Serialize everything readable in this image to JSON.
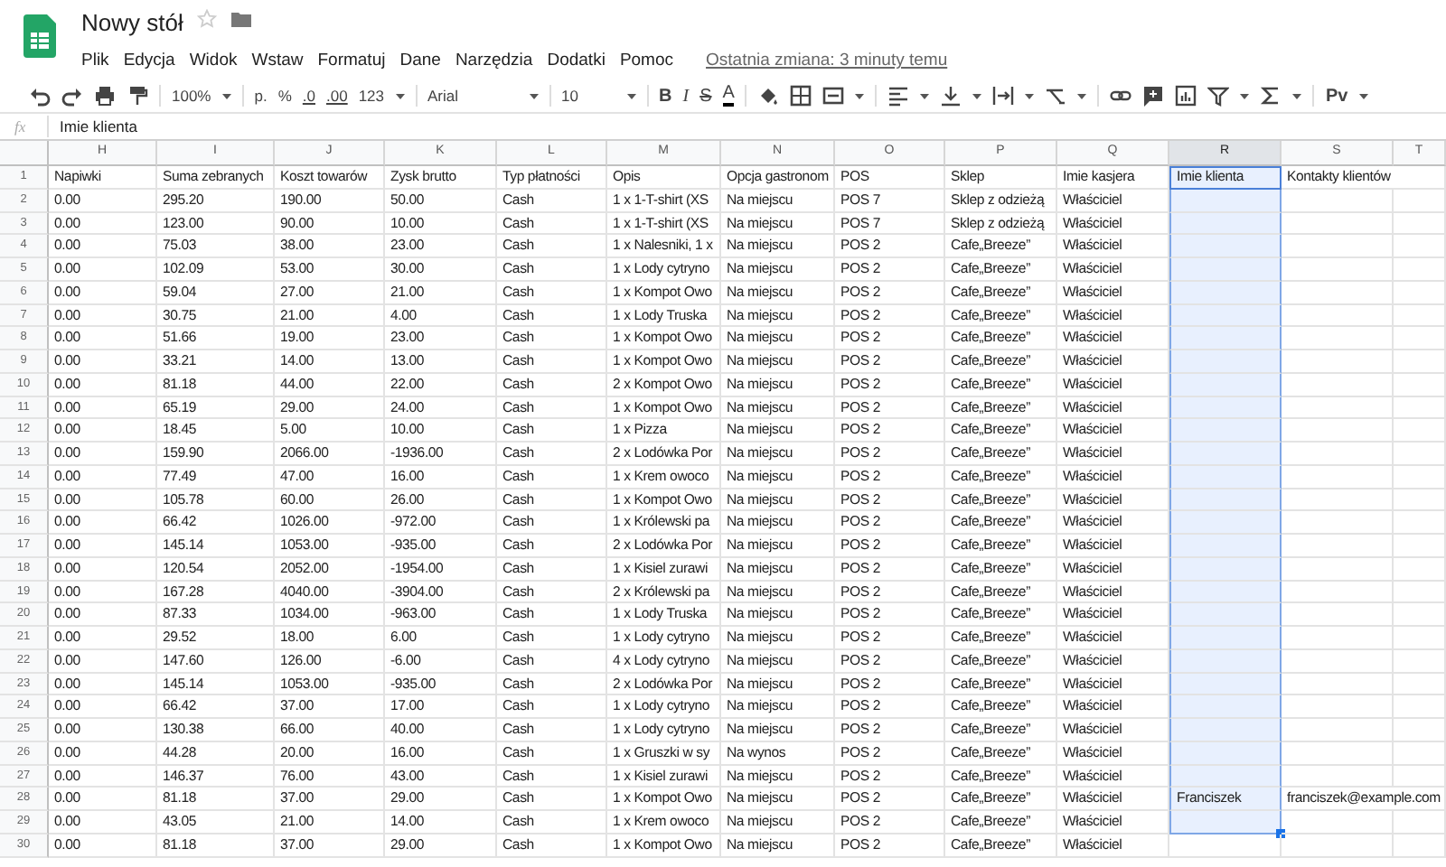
{
  "document": {
    "title": "Nowy stół",
    "starred": false
  },
  "menu": [
    "Plik",
    "Edycja",
    "Widok",
    "Wstaw",
    "Formatuj",
    "Dane",
    "Narzędzia",
    "Dodatki",
    "Pomoc"
  ],
  "last_edit": "Ostatnia zmiana: 3 minuty temu",
  "toolbar": {
    "zoom": "100%",
    "currency": "p.",
    "percent": "%",
    "decimal_less": ".0",
    "decimal_more": ".00",
    "number_format": "123",
    "font": "Arial",
    "font_size": "10",
    "bold": "B",
    "italic": "I",
    "strikethrough": "S",
    "text_color": "A",
    "input_tools": "Pv"
  },
  "formula_bar": {
    "label": "fx",
    "value": "Imie klienta"
  },
  "columns": [
    {
      "letter": "H",
      "selected": false
    },
    {
      "letter": "I",
      "selected": false
    },
    {
      "letter": "J",
      "selected": false
    },
    {
      "letter": "K",
      "selected": false
    },
    {
      "letter": "L",
      "selected": false
    },
    {
      "letter": "M",
      "selected": false
    },
    {
      "letter": "N",
      "selected": false
    },
    {
      "letter": "O",
      "selected": false
    },
    {
      "letter": "P",
      "selected": false
    },
    {
      "letter": "Q",
      "selected": false
    },
    {
      "letter": "R",
      "selected": true
    },
    {
      "letter": "S",
      "selected": false
    },
    {
      "letter": "T",
      "selected": false
    }
  ],
  "rows": [
    {
      "number": "1",
      "selected": true,
      "cells": [
        "Napiwki",
        "Suma zebranych",
        "Koszt towarów",
        "Zysk brutto",
        "Typ płatności",
        "Opis",
        "Opcja gastronom",
        "POS",
        "Sklep",
        "Imie kasjera",
        "Imie klienta",
        "Kontakty klientów",
        null
      ]
    },
    {
      "number": "2",
      "selected": true,
      "cells": [
        "0.00",
        "295.20",
        "190.00",
        "50.00",
        "Cash",
        "1 x 1-T-shirt (XS",
        "Na miejscu",
        "POS 7",
        "Sklep z odzieżą",
        "Właściciel",
        null,
        null,
        null
      ]
    },
    {
      "number": "3",
      "selected": true,
      "cells": [
        "0.00",
        "123.00",
        "90.00",
        "10.00",
        "Cash",
        "1 x 1-T-shirt (XS",
        "Na miejscu",
        "POS 7",
        "Sklep z odzieżą",
        "Właściciel",
        null,
        null,
        null
      ]
    },
    {
      "number": "4",
      "selected": true,
      "cells": [
        "0.00",
        "75.03",
        "38.00",
        "23.00",
        "Cash",
        "1 x Nalesniki, 1 x",
        "Na miejscu",
        "POS 2",
        "Cafe„Breeze”",
        "Właściciel",
        null,
        null,
        null
      ]
    },
    {
      "number": "5",
      "selected": true,
      "cells": [
        "0.00",
        "102.09",
        "53.00",
        "30.00",
        "Cash",
        "1 x Lody cytryno",
        "Na miejscu",
        "POS 2",
        "Cafe„Breeze”",
        "Właściciel",
        null,
        null,
        null
      ]
    },
    {
      "number": "6",
      "selected": true,
      "cells": [
        "0.00",
        "59.04",
        "27.00",
        "21.00",
        "Cash",
        "1 x Kompot Owo",
        "Na miejscu",
        "POS 2",
        "Cafe„Breeze”",
        "Właściciel",
        null,
        null,
        null
      ]
    },
    {
      "number": "7",
      "selected": true,
      "cells": [
        "0.00",
        "30.75",
        "21.00",
        "4.00",
        "Cash",
        "1 x Lody Truska",
        "Na miejscu",
        "POS 2",
        "Cafe„Breeze”",
        "Właściciel",
        null,
        null,
        null
      ]
    },
    {
      "number": "8",
      "selected": true,
      "cells": [
        "0.00",
        "51.66",
        "19.00",
        "23.00",
        "Cash",
        "1 x Kompot Owo",
        "Na miejscu",
        "POS 2",
        "Cafe„Breeze”",
        "Właściciel",
        null,
        null,
        null
      ]
    },
    {
      "number": "9",
      "selected": true,
      "cells": [
        "0.00",
        "33.21",
        "14.00",
        "13.00",
        "Cash",
        "1 x Kompot Owo",
        "Na miejscu",
        "POS 2",
        "Cafe„Breeze”",
        "Właściciel",
        null,
        null,
        null
      ]
    },
    {
      "number": "10",
      "selected": true,
      "cells": [
        "0.00",
        "81.18",
        "44.00",
        "22.00",
        "Cash",
        "2 x Kompot Owo",
        "Na miejscu",
        "POS 2",
        "Cafe„Breeze”",
        "Właściciel",
        null,
        null,
        null
      ]
    },
    {
      "number": "11",
      "selected": true,
      "cells": [
        "0.00",
        "65.19",
        "29.00",
        "24.00",
        "Cash",
        "1 x Kompot Owo",
        "Na miejscu",
        "POS 2",
        "Cafe„Breeze”",
        "Właściciel",
        null,
        null,
        null
      ]
    },
    {
      "number": "12",
      "selected": true,
      "cells": [
        "0.00",
        "18.45",
        "5.00",
        "10.00",
        "Cash",
        "1 x Pizza",
        "Na miejscu",
        "POS 2",
        "Cafe„Breeze”",
        "Właściciel",
        null,
        null,
        null
      ]
    },
    {
      "number": "13",
      "selected": true,
      "cells": [
        "0.00",
        "159.90",
        "2066.00",
        "-1936.00",
        "Cash",
        "2 x Lodówka Por",
        "Na miejscu",
        "POS 2",
        "Cafe„Breeze”",
        "Właściciel",
        null,
        null,
        null
      ]
    },
    {
      "number": "14",
      "selected": true,
      "cells": [
        "0.00",
        "77.49",
        "47.00",
        "16.00",
        "Cash",
        "1 x Krem owoco",
        "Na miejscu",
        "POS 2",
        "Cafe„Breeze”",
        "Właściciel",
        null,
        null,
        null
      ]
    },
    {
      "number": "15",
      "selected": true,
      "cells": [
        "0.00",
        "105.78",
        "60.00",
        "26.00",
        "Cash",
        "1 x Kompot Owo",
        "Na miejscu",
        "POS 2",
        "Cafe„Breeze”",
        "Właściciel",
        null,
        null,
        null
      ]
    },
    {
      "number": "16",
      "selected": true,
      "cells": [
        "0.00",
        "66.42",
        "1026.00",
        "-972.00",
        "Cash",
        "1 x Królewski pa",
        "Na miejscu",
        "POS 2",
        "Cafe„Breeze”",
        "Właściciel",
        null,
        null,
        null
      ]
    },
    {
      "number": "17",
      "selected": true,
      "cells": [
        "0.00",
        "145.14",
        "1053.00",
        "-935.00",
        "Cash",
        "2 x Lodówka Por",
        "Na miejscu",
        "POS 2",
        "Cafe„Breeze”",
        "Właściciel",
        null,
        null,
        null
      ]
    },
    {
      "number": "18",
      "selected": true,
      "cells": [
        "0.00",
        "120.54",
        "2052.00",
        "-1954.00",
        "Cash",
        "1 x Kisiel zurawi",
        "Na miejscu",
        "POS 2",
        "Cafe„Breeze”",
        "Właściciel",
        null,
        null,
        null
      ]
    },
    {
      "number": "19",
      "selected": true,
      "cells": [
        "0.00",
        "167.28",
        "4040.00",
        "-3904.00",
        "Cash",
        "2 x Królewski pa",
        "Na miejscu",
        "POS 2",
        "Cafe„Breeze”",
        "Właściciel",
        null,
        null,
        null
      ]
    },
    {
      "number": "20",
      "selected": true,
      "cells": [
        "0.00",
        "87.33",
        "1034.00",
        "-963.00",
        "Cash",
        "1 x Lody Truska",
        "Na miejscu",
        "POS 2",
        "Cafe„Breeze”",
        "Właściciel",
        null,
        null,
        null
      ]
    },
    {
      "number": "21",
      "selected": true,
      "cells": [
        "0.00",
        "29.52",
        "18.00",
        "6.00",
        "Cash",
        "1 x Lody cytryno",
        "Na miejscu",
        "POS 2",
        "Cafe„Breeze”",
        "Właściciel",
        null,
        null,
        null
      ]
    },
    {
      "number": "22",
      "selected": true,
      "cells": [
        "0.00",
        "147.60",
        "126.00",
        "-6.00",
        "Cash",
        "4 x Lody cytryno",
        "Na miejscu",
        "POS 2",
        "Cafe„Breeze”",
        "Właściciel",
        null,
        null,
        null
      ]
    },
    {
      "number": "23",
      "selected": true,
      "cells": [
        "0.00",
        "145.14",
        "1053.00",
        "-935.00",
        "Cash",
        "2 x Lodówka Por",
        "Na miejscu",
        "POS 2",
        "Cafe„Breeze”",
        "Właściciel",
        null,
        null,
        null
      ]
    },
    {
      "number": "24",
      "selected": true,
      "cells": [
        "0.00",
        "66.42",
        "37.00",
        "17.00",
        "Cash",
        "1 x Lody cytryno",
        "Na miejscu",
        "POS 2",
        "Cafe„Breeze”",
        "Właściciel",
        null,
        null,
        null
      ]
    },
    {
      "number": "25",
      "selected": true,
      "cells": [
        "0.00",
        "130.38",
        "66.00",
        "40.00",
        "Cash",
        "1 x Lody cytryno",
        "Na miejscu",
        "POS 2",
        "Cafe„Breeze”",
        "Właściciel",
        null,
        null,
        null
      ]
    },
    {
      "number": "26",
      "selected": true,
      "cells": [
        "0.00",
        "44.28",
        "20.00",
        "16.00",
        "Cash",
        "1 x Gruszki w sy",
        "Na wynos",
        "POS 2",
        "Cafe„Breeze”",
        "Właściciel",
        null,
        null,
        null
      ]
    },
    {
      "number": "27",
      "selected": true,
      "cells": [
        "0.00",
        "146.37",
        "76.00",
        "43.00",
        "Cash",
        "1 x Kisiel zurawi",
        "Na miejscu",
        "POS 2",
        "Cafe„Breeze”",
        "Właściciel",
        null,
        null,
        null
      ]
    },
    {
      "number": "28",
      "selected": true,
      "cells": [
        "0.00",
        "81.18",
        "37.00",
        "29.00",
        "Cash",
        "1 x Kompot Owo",
        "Na miejscu",
        "POS 2",
        "Cafe„Breeze”",
        "Właściciel",
        "Franciszek",
        "franciszek@example.com",
        null
      ]
    },
    {
      "number": "29",
      "selected": true,
      "cells": [
        "0.00",
        "43.05",
        "21.00",
        "14.00",
        "Cash",
        "1 x Krem owoco",
        "Na miejscu",
        "POS 2",
        "Cafe„Breeze”",
        "Właściciel",
        null,
        null,
        null
      ]
    },
    {
      "number": "30",
      "selected": false,
      "cells": [
        "0.00",
        "81.18",
        "37.00",
        "29.00",
        "Cash",
        "1 x Kompot Owo",
        "Na miejscu",
        "POS 2",
        "Cafe„Breeze”",
        "Właściciel",
        null,
        null,
        null
      ]
    }
  ]
}
